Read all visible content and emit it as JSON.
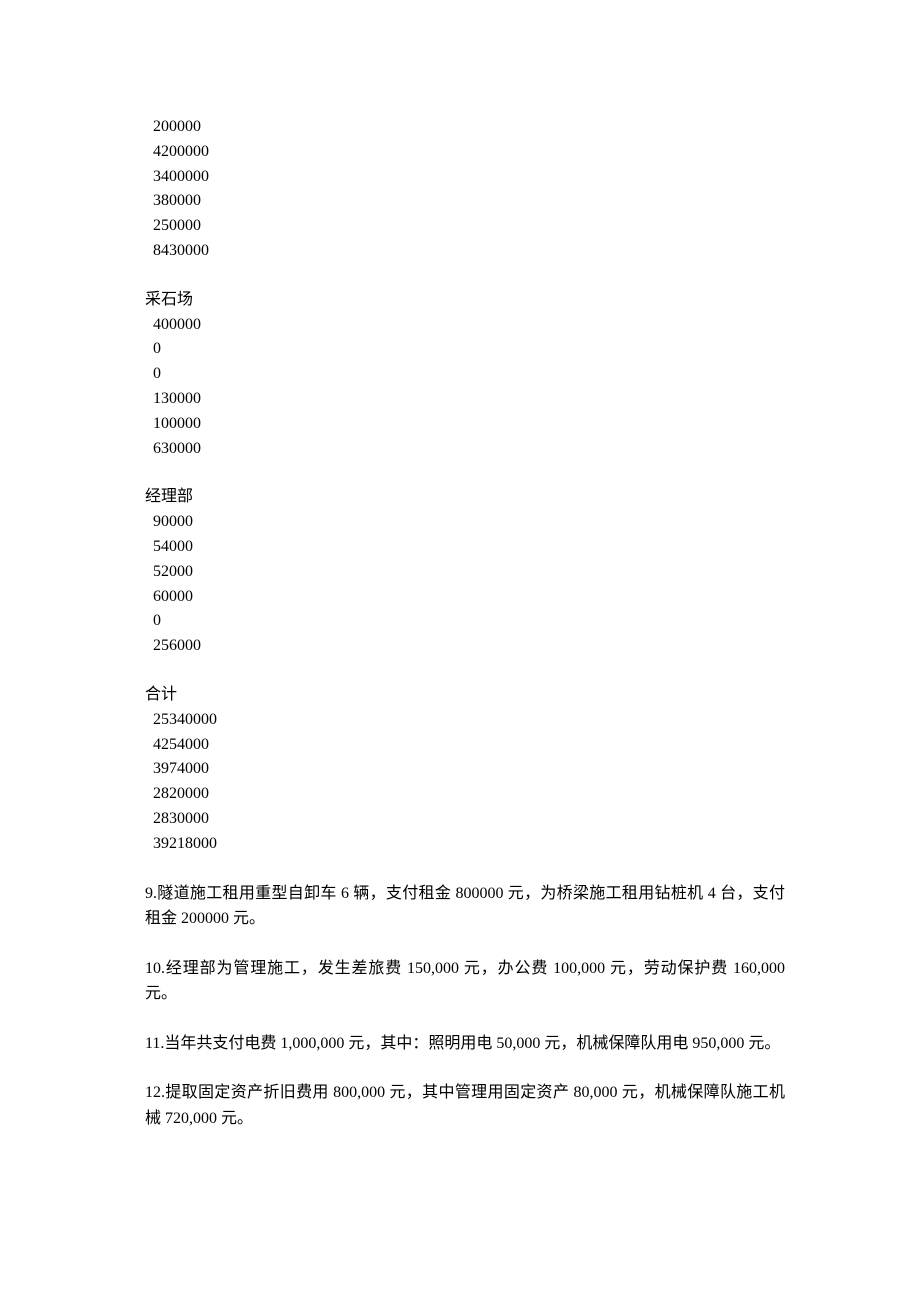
{
  "sections": [
    {
      "label": null,
      "values": [
        "200000",
        "4200000",
        "3400000",
        "380000",
        "250000",
        "8430000"
      ]
    },
    {
      "label": "采石场",
      "values": [
        "400000",
        "0",
        "0",
        "130000",
        "100000",
        "630000"
      ]
    },
    {
      "label": "经理部",
      "values": [
        "90000",
        "54000",
        "52000",
        "60000",
        "0",
        "256000"
      ]
    },
    {
      "label": "合计",
      "values": [
        "25340000",
        "4254000",
        "3974000",
        "2820000",
        "2830000",
        "39218000"
      ]
    }
  ],
  "paragraphs": [
    "9.隧道施工租用重型自卸车 6 辆，支付租金 800000 元，为桥梁施工租用钻桩机 4 台，支付租金 200000 元。",
    "10.经理部为管理施工，发生差旅费 150,000 元，办公费 100,000 元，劳动保护费 160,000元。",
    "11.当年共支付电费 1,000,000 元，其中：照明用电 50,000 元，机械保障队用电 950,000 元。",
    "12.提取固定资产折旧费用 800,000 元，其中管理用固定资产 80,000 元，机械保障队施工机械 720,000 元。"
  ]
}
